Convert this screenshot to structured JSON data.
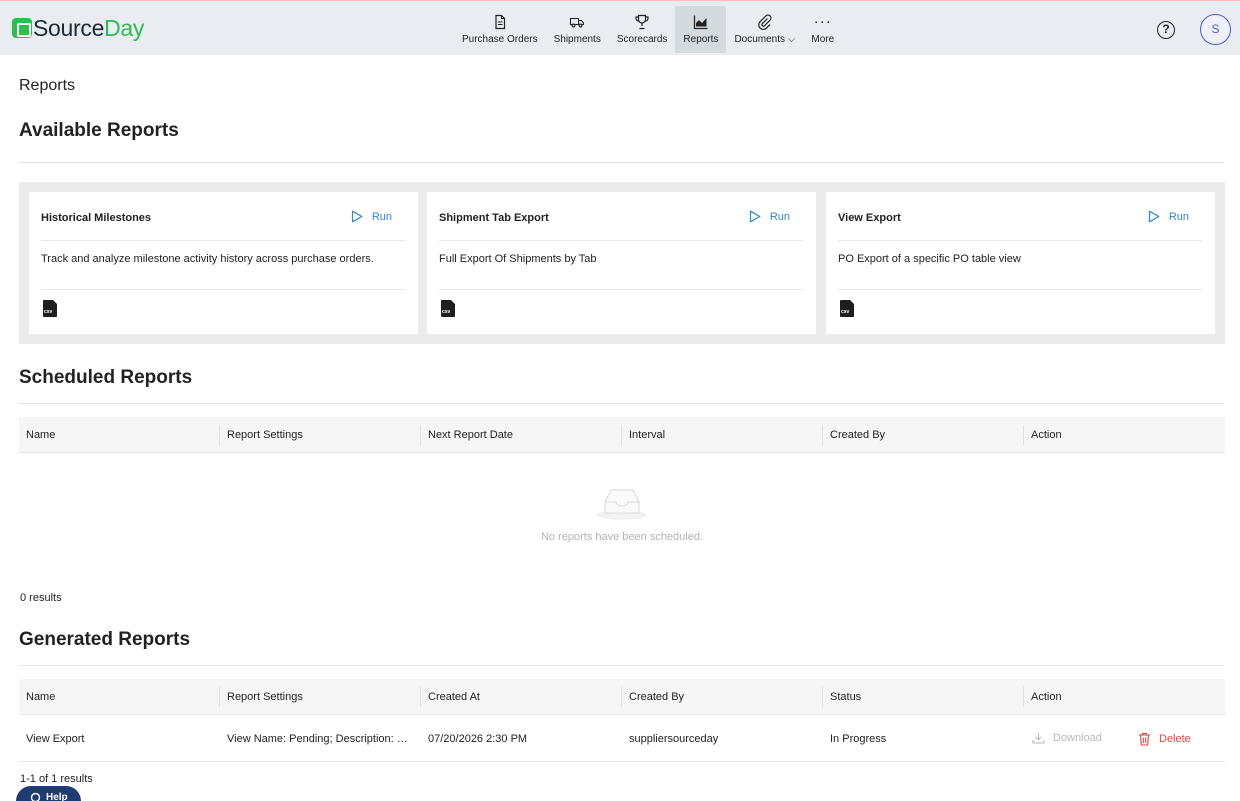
{
  "brand": {
    "name_part1": "Source",
    "name_part2": "Day"
  },
  "nav": {
    "items": [
      {
        "label": "Purchase Orders",
        "icon": "document-icon"
      },
      {
        "label": "Shipments",
        "icon": "truck-icon"
      },
      {
        "label": "Scorecards",
        "icon": "trophy-icon"
      },
      {
        "label": "Reports",
        "icon": "chart-icon",
        "active": true
      },
      {
        "label": "Documents",
        "icon": "paperclip-icon"
      },
      {
        "label": "More",
        "icon": "more-icon"
      }
    ]
  },
  "header": {
    "help": "?",
    "avatar_initial": "S"
  },
  "breadcrumb": "Reports",
  "available": {
    "title": "Available Reports",
    "run_label": "Run",
    "cards": [
      {
        "title": "Historical Milestones",
        "description": "Track and analyze milestone activity history across purchase orders.",
        "file_type": "csv"
      },
      {
        "title": "Shipment Tab Export",
        "description": "Full Export Of Shipments by Tab",
        "file_type": "csv"
      },
      {
        "title": "View Export",
        "description": "PO Export of a specific PO table view",
        "file_type": "csv"
      }
    ]
  },
  "scheduled": {
    "title": "Scheduled Reports",
    "columns": [
      "Name",
      "Report Settings",
      "Next Report Date",
      "Interval",
      "Created By",
      "Action"
    ],
    "empty_text": "No reports have been scheduled.",
    "results": "0 results"
  },
  "generated": {
    "title": "Generated Reports",
    "columns": [
      "Name",
      "Report Settings",
      "Created At",
      "Created By",
      "Status",
      "Action"
    ],
    "rows": [
      {
        "name": "View Export",
        "settings": "View Name: Pending; Description: Pending",
        "created_at": "07/20/2026 2:30 PM",
        "created_by": "suppliersourceday",
        "status": "In Progress",
        "download": "Download",
        "delete": "Delete"
      }
    ],
    "results": "1-1 of 1 results"
  },
  "help_button": "Help",
  "colors": {
    "brand_green": "#2ebd4e",
    "link_blue": "#2a86d6",
    "danger_red": "#e0443e",
    "help_navy": "#1f3b73"
  }
}
